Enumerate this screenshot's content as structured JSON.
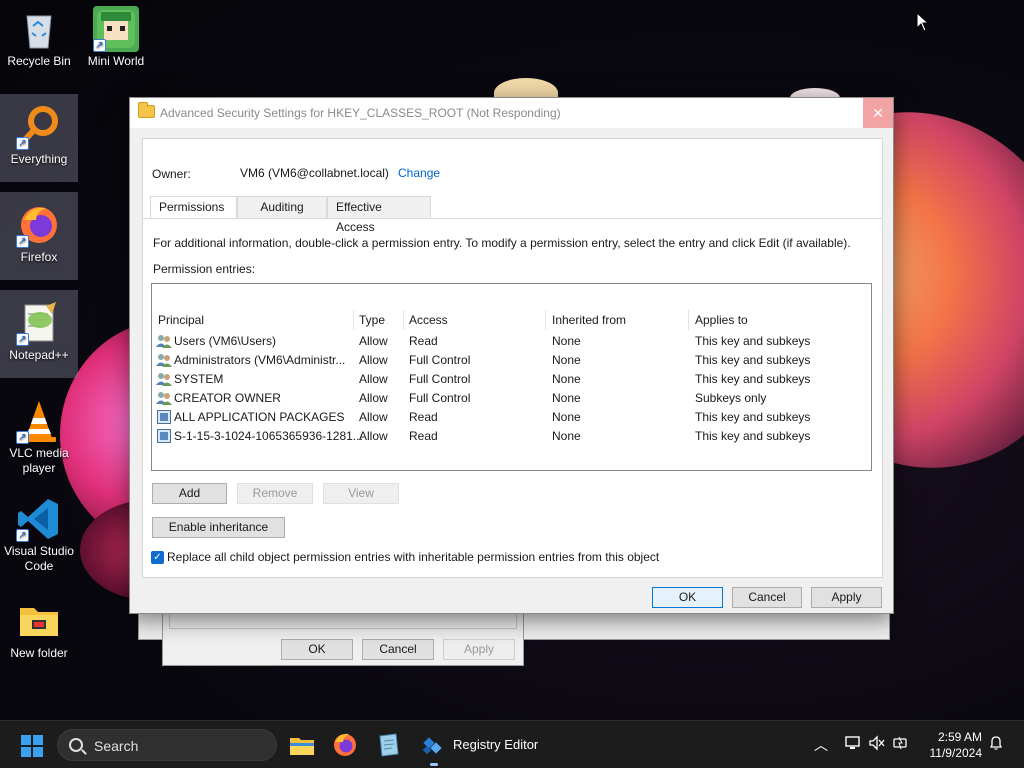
{
  "desktop": {
    "icons": [
      {
        "label": "Recycle Bin"
      },
      {
        "label": "Mini World"
      },
      {
        "label": "Everything"
      },
      {
        "label": "Firefox"
      },
      {
        "label": "Notepad++"
      },
      {
        "label": "VLC media player"
      },
      {
        "label": "Visual Studio Code"
      },
      {
        "label": "New folder"
      }
    ]
  },
  "background_dialog": {
    "ok_label": "OK",
    "cancel_label": "Cancel",
    "apply_label": "Apply"
  },
  "dialog": {
    "title": "Advanced Security Settings for HKEY_CLASSES_ROOT (Not Responding)",
    "close_glyph": "✕",
    "owner_label": "Owner:",
    "owner_value": "VM6 (VM6@collabnet.local)",
    "owner_change": "Change",
    "tabs": [
      {
        "label": "Permissions",
        "active": true
      },
      {
        "label": "Auditing",
        "active": false
      },
      {
        "label": "Effective Access",
        "active": false
      }
    ],
    "info_text": "For additional information, double-click a permission entry. To modify a permission entry, select the entry and click Edit (if available).",
    "entries_label": "Permission entries:",
    "columns": [
      "Principal",
      "Type",
      "Access",
      "Inherited from",
      "Applies to"
    ],
    "rows": [
      {
        "icon": "users-icon",
        "principal": "Users (VM6\\Users)",
        "type": "Allow",
        "access": "Read",
        "inherited": "None",
        "applies": "This key and subkeys"
      },
      {
        "icon": "users-icon",
        "principal": "Administrators (VM6\\Administr...",
        "type": "Allow",
        "access": "Full Control",
        "inherited": "None",
        "applies": "This key and subkeys"
      },
      {
        "icon": "users-icon",
        "principal": "SYSTEM",
        "type": "Allow",
        "access": "Full Control",
        "inherited": "None",
        "applies": "This key and subkeys"
      },
      {
        "icon": "users-icon",
        "principal": "CREATOR OWNER",
        "type": "Allow",
        "access": "Full Control",
        "inherited": "None",
        "applies": "Subkeys only"
      },
      {
        "icon": "package-icon",
        "principal": "ALL APPLICATION PACKAGES",
        "type": "Allow",
        "access": "Read",
        "inherited": "None",
        "applies": "This key and subkeys"
      },
      {
        "icon": "package-icon",
        "principal": "S-1-15-3-1024-1065365936-1281...",
        "type": "Allow",
        "access": "Read",
        "inherited": "None",
        "applies": "This key and subkeys"
      }
    ],
    "add_label": "Add",
    "remove_label": "Remove",
    "view_label": "View",
    "enable_inheritance_label": "Enable inheritance",
    "replace_checkbox_label": "Replace all child object permission entries with inheritable permission entries from this object",
    "replace_checked": true,
    "ok_label": "OK",
    "cancel_label": "Cancel",
    "apply_label": "Apply"
  },
  "taskbar": {
    "search_label": "Search",
    "active_app_label": "Registry Editor",
    "time": "2:59 AM",
    "date": "11/9/2024",
    "accent": "#3aa0f0"
  }
}
